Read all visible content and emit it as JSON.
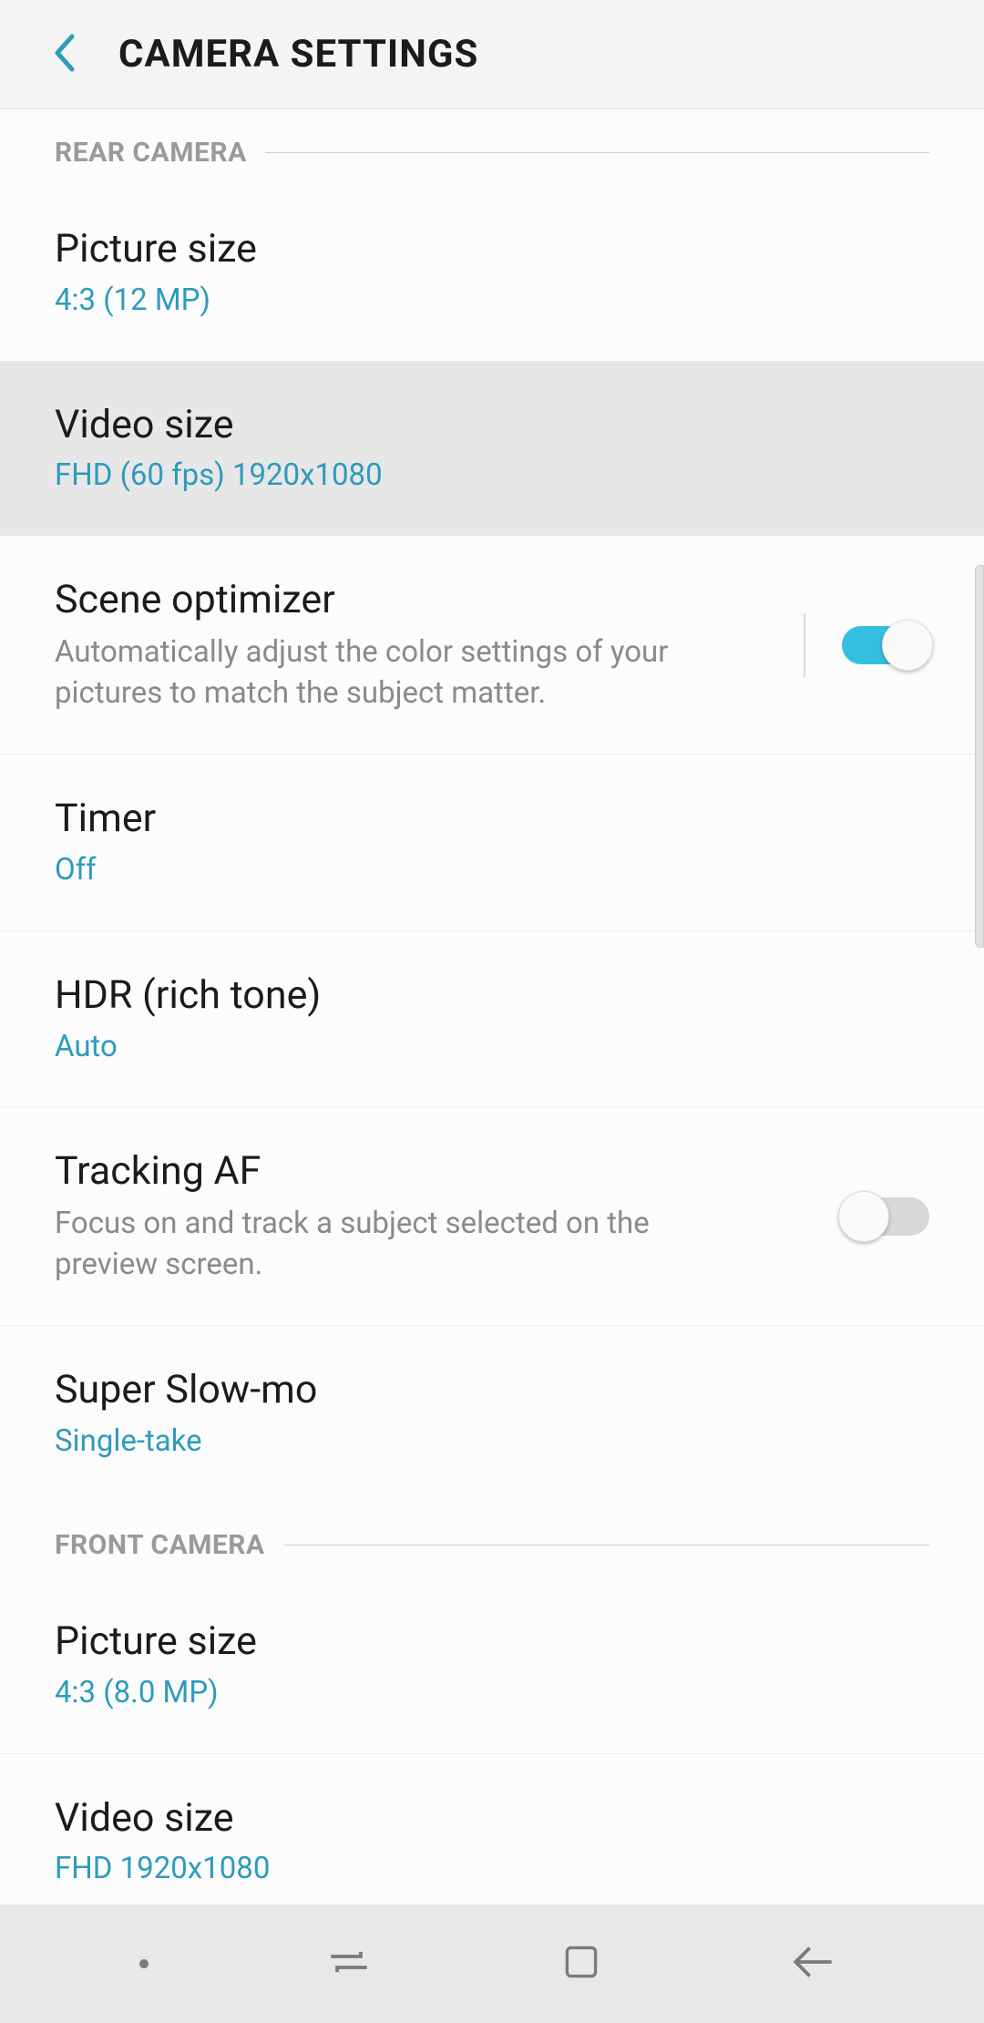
{
  "header": {
    "title": "CAMERA SETTINGS"
  },
  "sections": {
    "rear": {
      "header": "REAR CAMERA",
      "picture_size": {
        "title": "Picture size",
        "value": "4:3 (12 MP)"
      },
      "video_size": {
        "title": "Video size",
        "value": "FHD (60 fps) 1920x1080"
      },
      "scene_optimizer": {
        "title": "Scene optimizer",
        "desc": "Automatically adjust the color settings of your pictures to match the subject matter.",
        "enabled": true
      },
      "timer": {
        "title": "Timer",
        "value": "Off"
      },
      "hdr": {
        "title": "HDR (rich tone)",
        "value": "Auto"
      },
      "tracking_af": {
        "title": "Tracking AF",
        "desc": "Focus on and track a subject selected on the preview screen.",
        "enabled": false
      },
      "super_slowmo": {
        "title": "Super Slow-mo",
        "value": "Single-take"
      }
    },
    "front": {
      "header": "FRONT CAMERA",
      "picture_size": {
        "title": "Picture size",
        "value": "4:3 (8.0 MP)"
      },
      "video_size": {
        "title": "Video size",
        "value": "FHD 1920x1080"
      }
    }
  }
}
